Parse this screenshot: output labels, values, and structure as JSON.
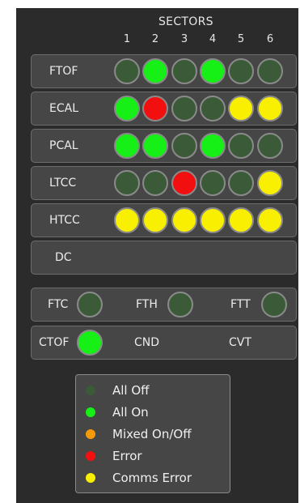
{
  "colors": {
    "off": "#3b5a38",
    "on": "#16f016",
    "mixed": "#f59a0a",
    "error": "#f20f0f",
    "comms": "#f8f000"
  },
  "sectors": {
    "title": "SECTORS",
    "numbers": [
      "1",
      "2",
      "3",
      "4",
      "5",
      "6"
    ]
  },
  "detectors": [
    {
      "label": "FTOF",
      "states": [
        "off",
        "on",
        "off",
        "on",
        "off",
        "off"
      ]
    },
    {
      "label": "ECAL",
      "states": [
        "on",
        "error",
        "off",
        "off",
        "comms",
        "comms"
      ]
    },
    {
      "label": "PCAL",
      "states": [
        "on",
        "on",
        "off",
        "on",
        "off",
        "off"
      ]
    },
    {
      "label": "LTCC",
      "states": [
        "off",
        "off",
        "error",
        "off",
        "off",
        "comms"
      ]
    },
    {
      "label": "HTCC",
      "states": [
        "comms",
        "comms",
        "comms",
        "comms",
        "comms",
        "comms"
      ]
    },
    {
      "label": "DC",
      "states": []
    }
  ],
  "forward": [
    {
      "label": "FTC",
      "state": "off"
    },
    {
      "label": "FTH",
      "state": "off"
    },
    {
      "label": "FTT",
      "state": "off"
    }
  ],
  "central": [
    {
      "label": "CTOF",
      "state": "on"
    },
    {
      "label": "CND",
      "state": null
    },
    {
      "label": "CVT",
      "state": null
    }
  ],
  "legend": [
    {
      "state": "off",
      "label": "All Off"
    },
    {
      "state": "on",
      "label": "All On"
    },
    {
      "state": "mixed",
      "label": "Mixed On/Off"
    },
    {
      "state": "error",
      "label": "Error"
    },
    {
      "state": "comms",
      "label": "Comms Error"
    }
  ]
}
